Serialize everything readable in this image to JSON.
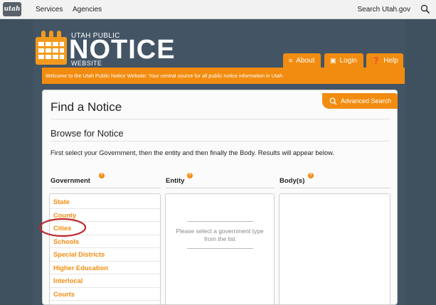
{
  "topbar": {
    "logo_text": "utah",
    "nav": [
      "Services",
      "Agencies"
    ],
    "search_label": "Search Utah.gov"
  },
  "header": {
    "brand_small": "UTAH PUBLIC",
    "brand_big": "NOTICE",
    "brand_sub": "WEBSITE",
    "buttons": {
      "about": "About",
      "login": "Login",
      "help": "Help"
    },
    "welcome": "Welcome to the Utah Public Notice Website: Your central source for all public notice information in Utah"
  },
  "main": {
    "advanced_search": "Advanced Search",
    "title": "Find a Notice",
    "browse_title": "Browse for Notice",
    "instructions": "First select your Government, then the entity and then finally the Body. Results will appear below.",
    "columns": {
      "government": "Government",
      "entity": "Entity",
      "body": "Body(s)"
    },
    "government_items": [
      "State",
      "County",
      "Cities",
      "Schools",
      "Special Districts",
      "Higher Education",
      "Interlocal",
      "Courts"
    ],
    "entity_message": "Please select a government type from the list"
  },
  "colors": {
    "accent": "#f28c10",
    "background": "#3f505f",
    "highlight_circle": "#c0282d"
  }
}
